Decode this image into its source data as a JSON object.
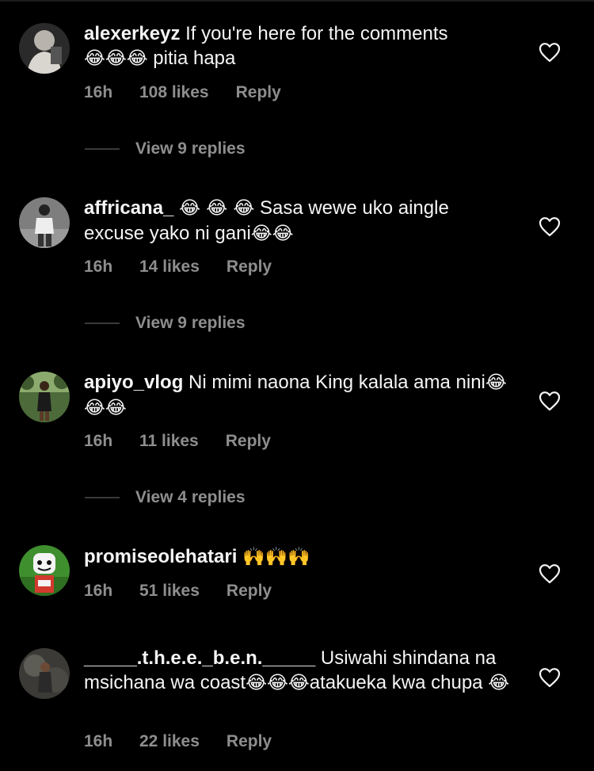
{
  "comments": [
    {
      "username": "alexerkeyz",
      "text": "If you're here for the comments ",
      "emoji_a": "😂😂😂",
      "text_b": " pitia hapa",
      "emoji_b": "",
      "text_c": "",
      "time": "16h",
      "likes": "108 likes",
      "reply": "Reply",
      "view_replies": "View 9 replies"
    },
    {
      "username": "affricana_",
      "text": " ",
      "emoji_a": "😂 😂 😂",
      "text_b": " Sasa wewe uko aingle excuse yako ni gani",
      "emoji_b": "😂😂",
      "text_c": "",
      "time": "16h",
      "likes": "14 likes",
      "reply": "Reply",
      "view_replies": "View 9 replies"
    },
    {
      "username": "apiyo_vlog",
      "text": " Ni mimi naona King kalala ama nini",
      "emoji_a": "😂😂😂",
      "text_b": "",
      "emoji_b": "",
      "text_c": "",
      "time": "16h",
      "likes": "11 likes",
      "reply": "Reply",
      "view_replies": "View 4 replies"
    },
    {
      "username": "promiseolehatari",
      "text": " ",
      "emoji_a": "🙌🙌🙌",
      "text_b": "",
      "emoji_b": "",
      "text_c": "",
      "time": "16h",
      "likes": "51 likes",
      "reply": "Reply",
      "view_replies": ""
    },
    {
      "username": "_____.t.h.e.e._b.e.n._____",
      "text": " Usiwahi shindana na msichana wa coast",
      "emoji_a": "😂😂😂",
      "text_b": "atakueka kwa chupa ",
      "emoji_b": "😂",
      "text_c": "",
      "time": "16h",
      "likes": "22 likes",
      "reply": "Reply",
      "view_replies": ""
    }
  ],
  "icons": {
    "like": "heart-outline-icon"
  },
  "colors": {
    "background": "#000000",
    "primary_text": "#f5f5f5",
    "secondary_text": "#8e8e8e"
  }
}
